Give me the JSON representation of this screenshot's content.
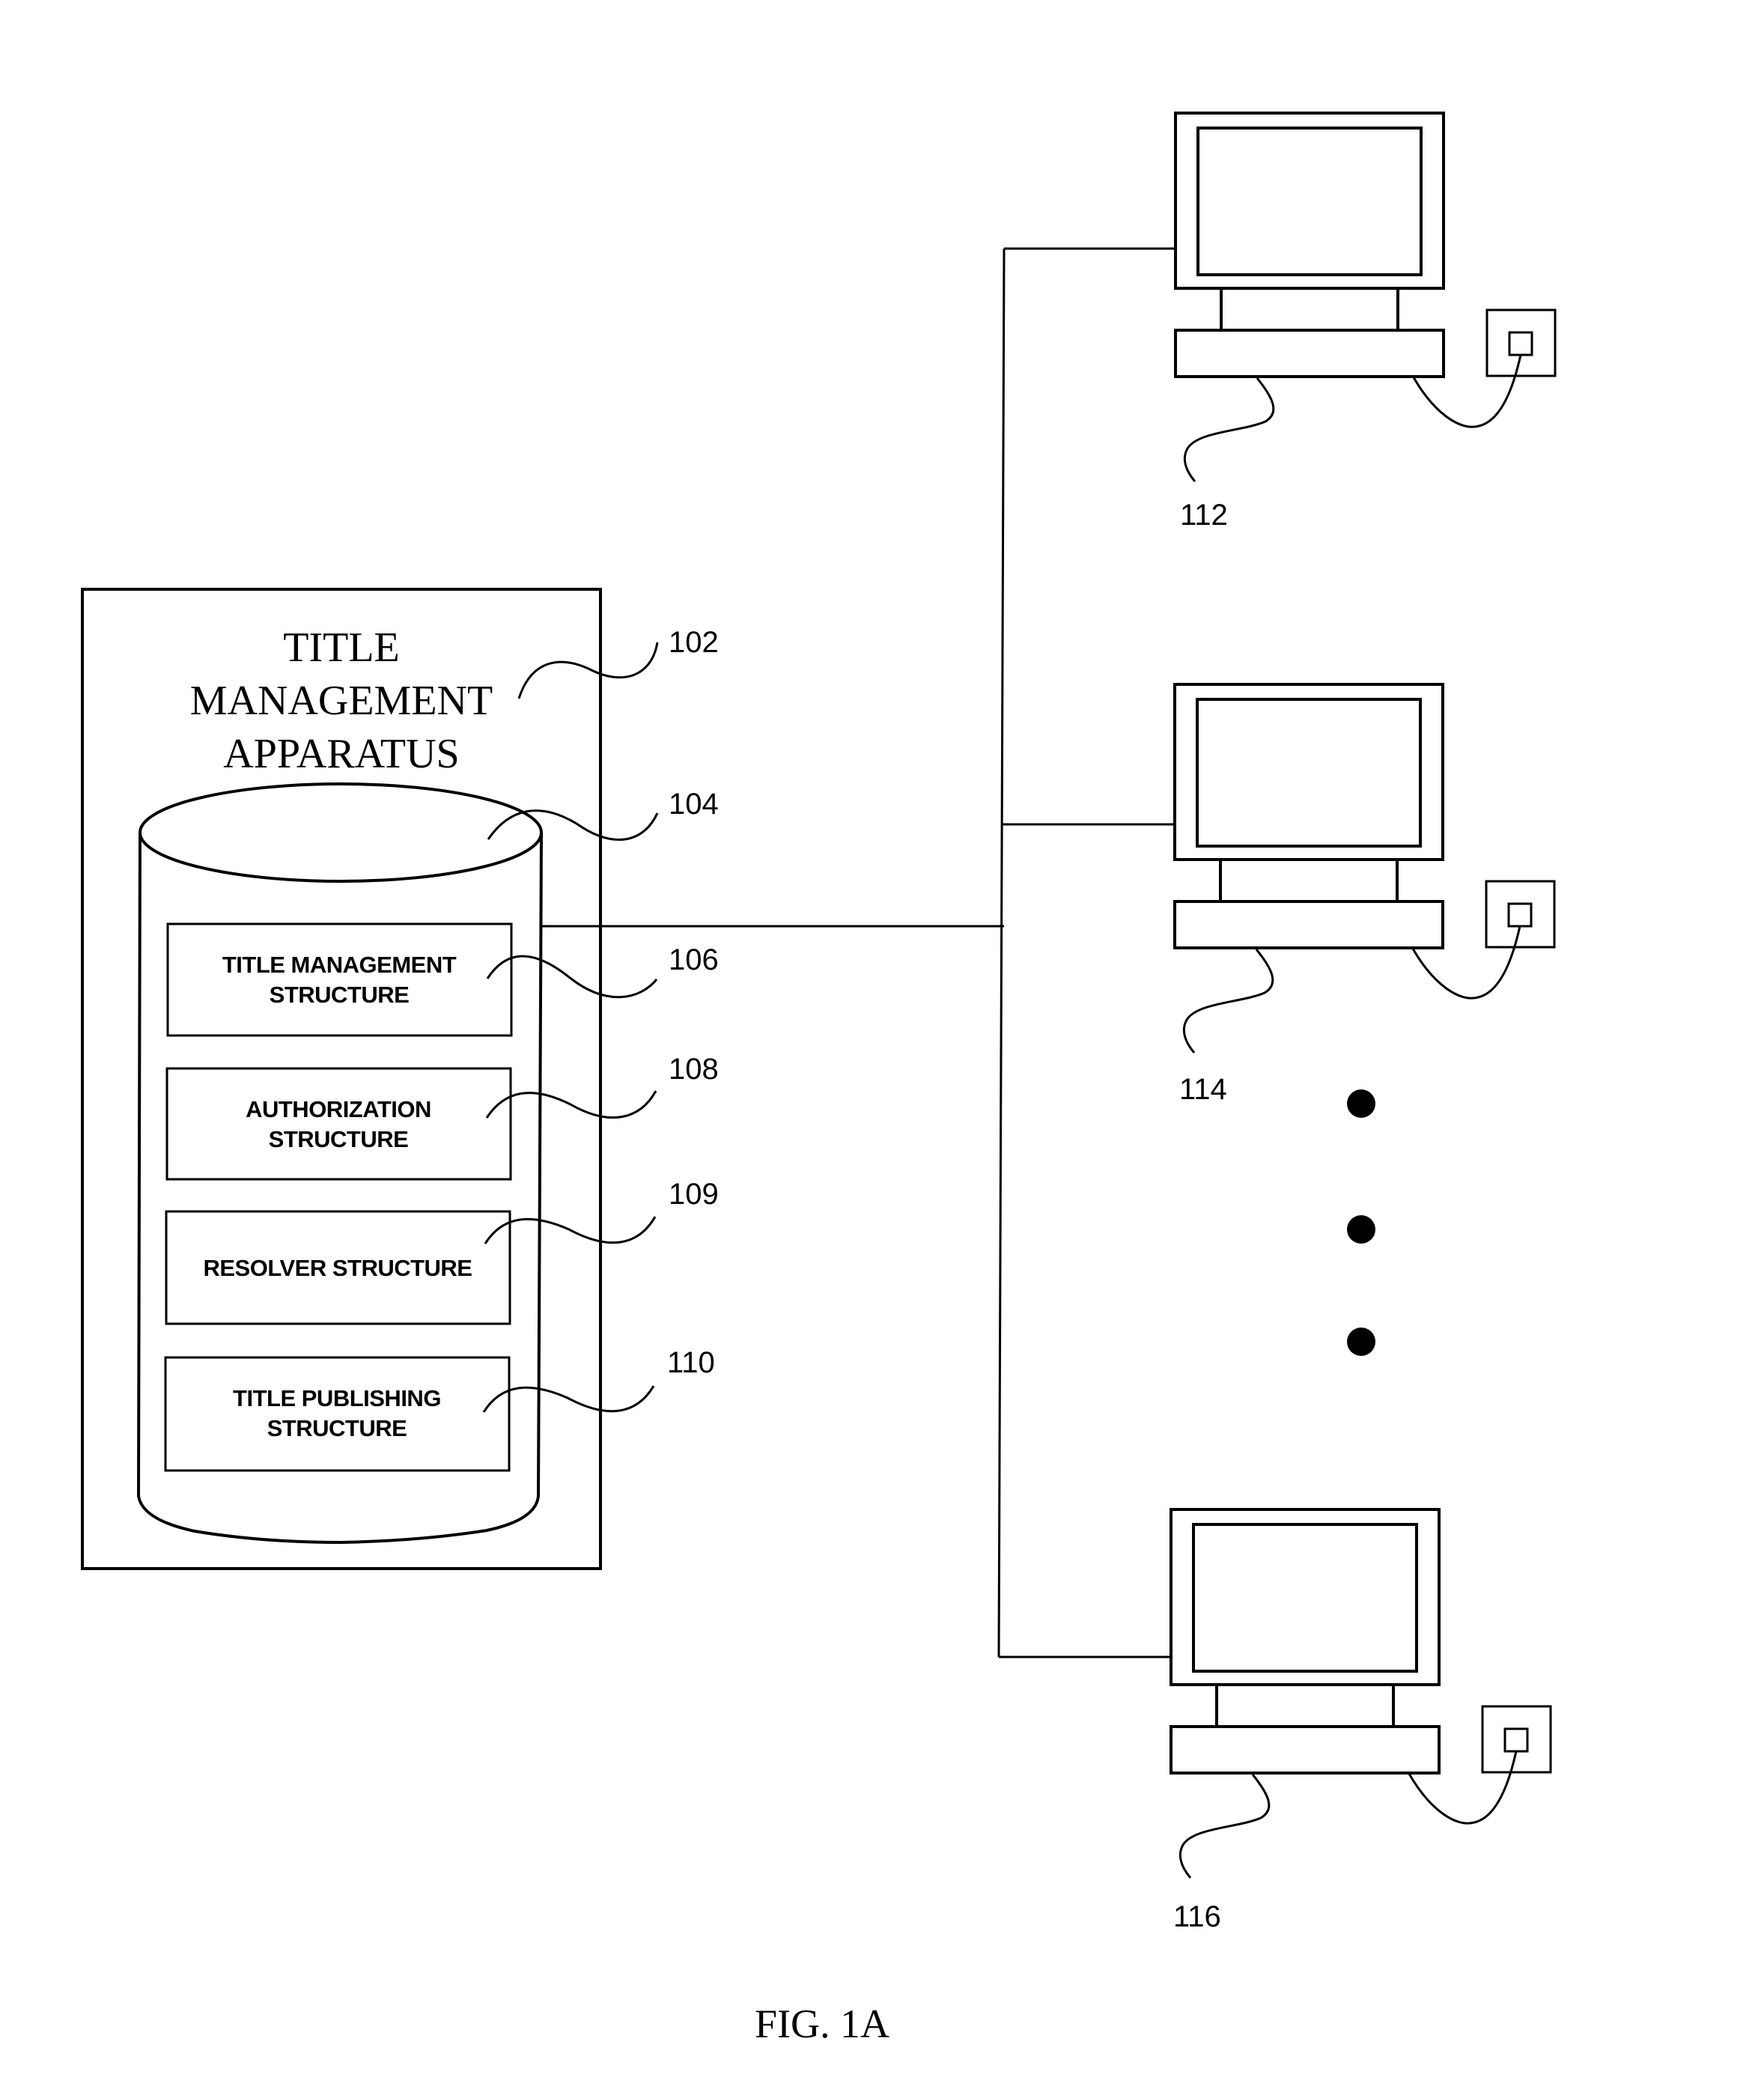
{
  "figure": {
    "label": "FIG. 1A",
    "type": "patent system block diagram"
  },
  "apparatus": {
    "ref": "102",
    "title_lines": [
      "TITLE",
      "MANAGEMENT",
      "APPARATUS"
    ],
    "database": {
      "ref": "104",
      "structures": [
        {
          "ref": "106",
          "lines": [
            "TITLE MANAGEMENT",
            "STRUCTURE"
          ]
        },
        {
          "ref": "108",
          "lines": [
            "AUTHORIZATION",
            "STRUCTURE"
          ]
        },
        {
          "ref": "109",
          "lines": [
            "RESOLVER STRUCTURE"
          ]
        },
        {
          "ref": "110",
          "lines": [
            "TITLE PUBLISHING",
            "STRUCTURE"
          ]
        }
      ]
    }
  },
  "clients": [
    {
      "ref": "112",
      "icon": "computer-icon"
    },
    {
      "ref": "114",
      "icon": "computer-icon"
    },
    {
      "ref": "116",
      "icon": "computer-icon"
    }
  ],
  "ellipsis": {
    "icon": "vertical-ellipsis-dots",
    "count": 3
  }
}
